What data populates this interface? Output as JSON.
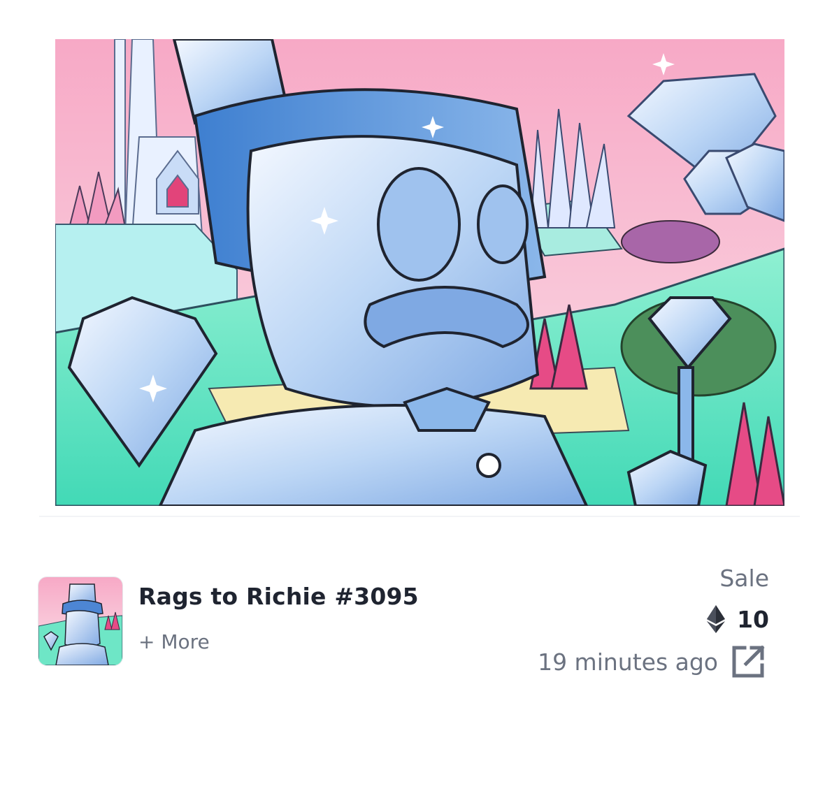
{
  "artwork": {
    "icon": "nft-artwork-image",
    "alt_subject": "crystal gentleman with top hat"
  },
  "item": {
    "name": "Rags to Richie #3095",
    "more_label": "+ More",
    "thumbnail_icon": "collection-thumbnail-image"
  },
  "event": {
    "type": "Sale",
    "price": "10",
    "currency_icon": "ethereum-icon",
    "time": "19 minutes ago",
    "link_icon": "external-link-icon"
  },
  "colors": {
    "text_primary": "#1f2430",
    "text_secondary": "#6b7280"
  }
}
